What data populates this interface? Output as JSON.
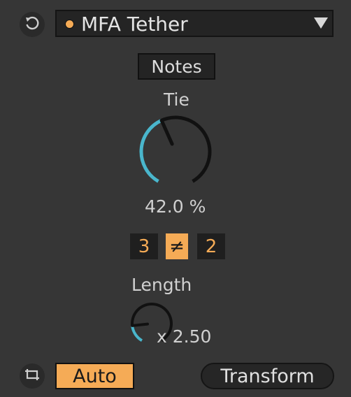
{
  "header": {
    "reset_icon": "reset-icon",
    "device_name": "MFA Tether",
    "indicator_color": "#f5ab56",
    "dropdown_icon": "triangle-down-icon"
  },
  "notes_button": {
    "label": "Notes"
  },
  "tie": {
    "label": "Tie",
    "value_text": "42.0 %",
    "value_fraction": 0.42
  },
  "ratio": {
    "numerator": "3",
    "operator": "≠",
    "denominator": "2"
  },
  "length": {
    "label": "Length",
    "value_text": "x 2.50",
    "value_fraction": 0.18
  },
  "footer": {
    "loop_icon": "loop-icon",
    "auto_label": "Auto",
    "transform_label": "Transform"
  },
  "colors": {
    "accent": "#f5ab56",
    "knob_arc": "#4ab6cc",
    "knob_track": "#111111",
    "background": "#363636"
  }
}
